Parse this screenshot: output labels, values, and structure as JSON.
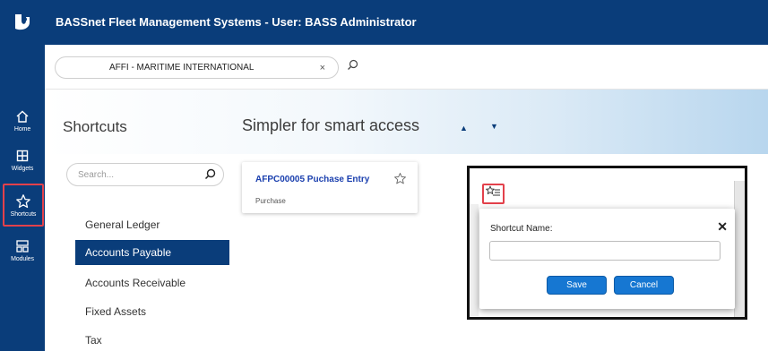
{
  "app": {
    "title": "BASSnet Fleet Management Systems - User: BASS Administrator"
  },
  "vessel": {
    "name": "AFFI - MARITIME INTERNATIONAL",
    "clear": "×"
  },
  "rail": {
    "items": [
      {
        "label": "Home",
        "icon": "home-icon"
      },
      {
        "label": "Widgets",
        "icon": "widgets-icon"
      },
      {
        "label": "Shortcuts",
        "icon": "star-icon"
      },
      {
        "label": "Modules",
        "icon": "modules-icon"
      }
    ]
  },
  "header": {
    "title": "Shortcuts",
    "subtitle": "Simpler for smart access",
    "up": "▲",
    "down": "▼"
  },
  "sidebar": {
    "search_placeholder": "Search...",
    "modules": [
      {
        "label": "General Ledger"
      },
      {
        "label": "Accounts Payable"
      },
      {
        "label": "Accounts Receivable"
      },
      {
        "label": "Fixed Assets"
      },
      {
        "label": "Tax"
      }
    ]
  },
  "shortcut_card": {
    "title": "AFPC00005 Puchase  Entry",
    "subtitle": "Purchase"
  },
  "dialog": {
    "label": "Shortcut Name:",
    "close": "✕",
    "input_value": "",
    "save": "Save",
    "cancel": "Cancel"
  },
  "colors": {
    "primary": "#0a3d7a",
    "highlight": "#e3414b",
    "button": "#1677d2",
    "link": "#1a3fae"
  }
}
